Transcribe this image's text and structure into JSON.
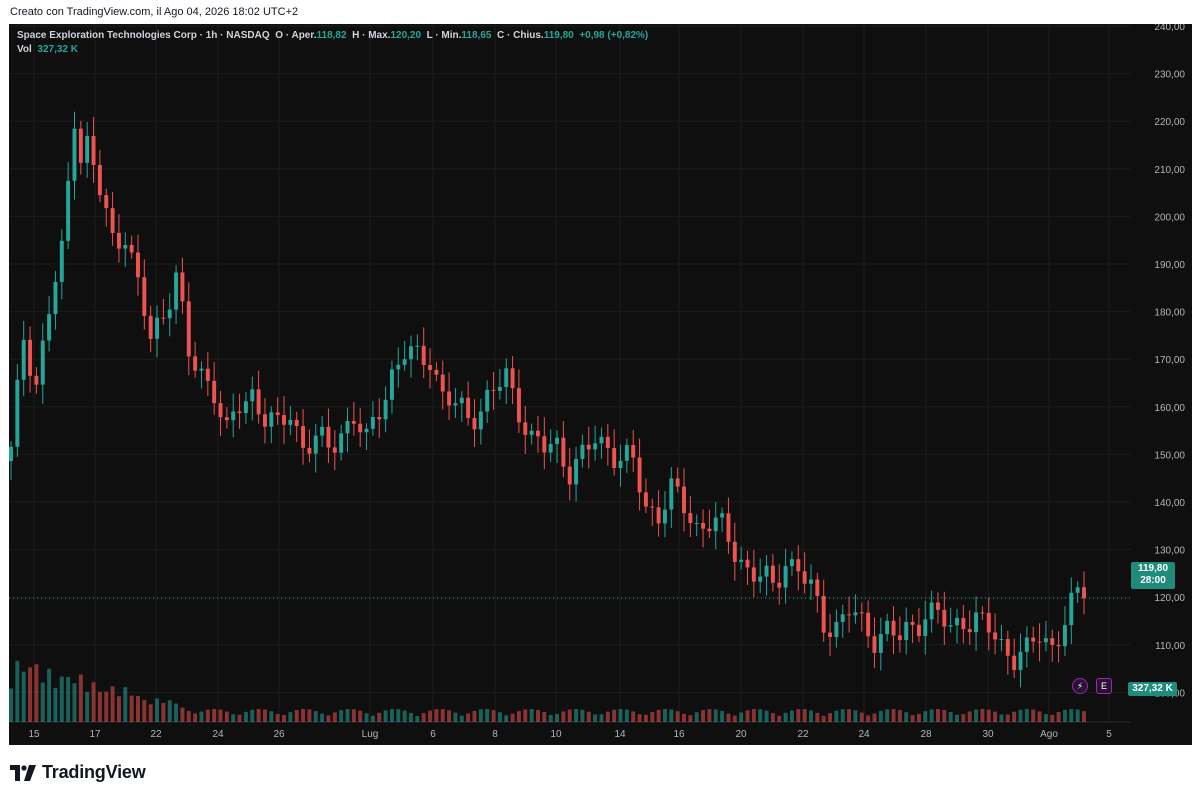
{
  "caption": "Creato con TradingView.com, il Ago 04, 2026 18:02 UTC+2",
  "legend": {
    "symbol": "Space Exploration Technologies Corp · 1h · NASDAQ",
    "open_label": "O · Aper.",
    "open": "118,82",
    "high_label": "H · Max.",
    "high": "120,20",
    "low_label": "L · Min.",
    "low": "118,65",
    "close_label": "C · Chius.",
    "close": "119,80",
    "change": "+0,98 (+0,82%)",
    "vol_label": "Vol",
    "vol": "327,32 K"
  },
  "price_tag": {
    "price": "119,80",
    "countdown": "28:00"
  },
  "vol_tag": "327,32 K",
  "events": {
    "lightning": "⚡",
    "earnings": "E"
  },
  "brand": "TradingView",
  "colors": {
    "up": "#26a69a",
    "down": "#ef5350",
    "background": "#0f0f0f",
    "grid": "#1c1c1c"
  },
  "chart_data": {
    "type": "candlestick",
    "y_ticks": [
      "240,00",
      "230,00",
      "220,00",
      "210,00",
      "200,00",
      "190,00",
      "180,00",
      "170,00",
      "160,00",
      "150,00",
      "140,00",
      "130,00",
      "120,00",
      "110,00",
      "100,00"
    ],
    "ylim": [
      95,
      240
    ],
    "x_ticks": [
      "15",
      "17",
      "22",
      "24",
      "26",
      "Lug",
      "6",
      "8",
      "10",
      "14",
      "16",
      "20",
      "22",
      "24",
      "28",
      "30",
      "Ago",
      "5"
    ],
    "last_price": 119.8,
    "close_path": [
      [
        0,
        150
      ],
      [
        2,
        175
      ],
      [
        4,
        165
      ],
      [
        6,
        180
      ],
      [
        8,
        192
      ],
      [
        10,
        222
      ],
      [
        11,
        213
      ],
      [
        12,
        215
      ],
      [
        14,
        205
      ],
      [
        16,
        195
      ],
      [
        18,
        197
      ],
      [
        20,
        185
      ],
      [
        22,
        174
      ],
      [
        24,
        180
      ],
      [
        26,
        188
      ],
      [
        28,
        170
      ],
      [
        30,
        167
      ],
      [
        32,
        164
      ],
      [
        34,
        154
      ],
      [
        36,
        160
      ],
      [
        38,
        163
      ],
      [
        40,
        158
      ],
      [
        42,
        155
      ],
      [
        44,
        159
      ],
      [
        46,
        152
      ],
      [
        48,
        153
      ],
      [
        50,
        151
      ],
      [
        52,
        155
      ],
      [
        54,
        158
      ],
      [
        56,
        152
      ],
      [
        58,
        160
      ],
      [
        60,
        167
      ],
      [
        62,
        171
      ],
      [
        64,
        170
      ],
      [
        66,
        171
      ],
      [
        68,
        162
      ],
      [
        70,
        160
      ],
      [
        72,
        158
      ],
      [
        74,
        160
      ],
      [
        76,
        163
      ],
      [
        78,
        166
      ],
      [
        80,
        160
      ],
      [
        82,
        153
      ],
      [
        84,
        151
      ],
      [
        86,
        152
      ],
      [
        88,
        147
      ],
      [
        90,
        149
      ],
      [
        92,
        153
      ],
      [
        94,
        152
      ],
      [
        96,
        149
      ],
      [
        98,
        148
      ],
      [
        100,
        139
      ],
      [
        102,
        138
      ],
      [
        104,
        142
      ],
      [
        106,
        139
      ],
      [
        108,
        135
      ],
      [
        110,
        136
      ],
      [
        112,
        134
      ],
      [
        114,
        130
      ],
      [
        116,
        126
      ],
      [
        118,
        124
      ],
      [
        120,
        122
      ],
      [
        122,
        128
      ],
      [
        124,
        126
      ],
      [
        126,
        121
      ],
      [
        128,
        115
      ],
      [
        130,
        114
      ],
      [
        132,
        117
      ],
      [
        134,
        114
      ],
      [
        136,
        112
      ],
      [
        138,
        113
      ],
      [
        140,
        111
      ],
      [
        142,
        114
      ],
      [
        144,
        117
      ],
      [
        146,
        116
      ],
      [
        148,
        113
      ],
      [
        150,
        116
      ],
      [
        152,
        115
      ],
      [
        154,
        113
      ],
      [
        156,
        110
      ],
      [
        158,
        108
      ],
      [
        160,
        108
      ],
      [
        162,
        112
      ],
      [
        164,
        110
      ],
      [
        166,
        115
      ],
      [
        168,
        120
      ]
    ],
    "volume_note": "histogram, max near start"
  }
}
